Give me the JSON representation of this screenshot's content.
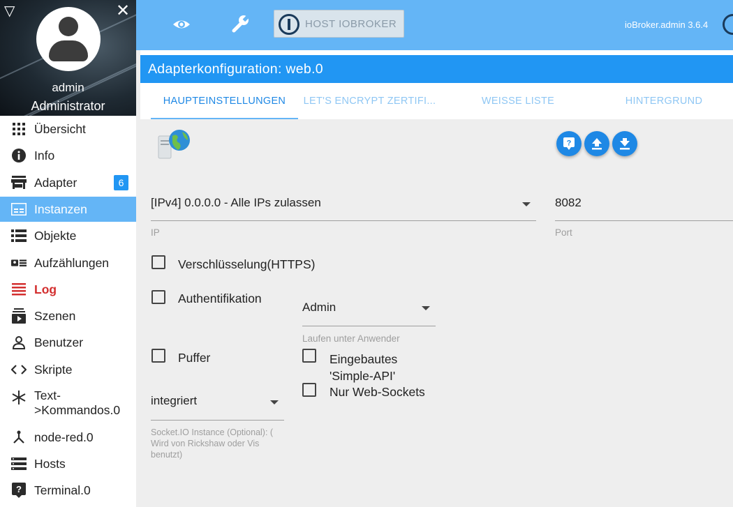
{
  "sidebar": {
    "user": {
      "name": "admin",
      "role": "Administrator"
    },
    "items": [
      {
        "label": "Übersicht",
        "icon": "grid-icon"
      },
      {
        "label": "Info",
        "icon": "info-icon"
      },
      {
        "label": "Adapter",
        "icon": "store-icon",
        "badge": "6"
      },
      {
        "label": "Instanzen",
        "icon": "instances-icon",
        "active": true
      },
      {
        "label": "Objekte",
        "icon": "list-icon"
      },
      {
        "label": "Aufzählungen",
        "icon": "enum-icon"
      },
      {
        "label": "Log",
        "icon": "log-icon",
        "highlight": "#d32f2f"
      },
      {
        "label": "Szenen",
        "icon": "scenes-icon"
      },
      {
        "label": "Benutzer",
        "icon": "user-icon"
      },
      {
        "label": "Skripte",
        "icon": "code-icon"
      },
      {
        "label": "Text-\n>Kommandos.0",
        "icon": "snowflake-icon"
      },
      {
        "label": "node-red.0",
        "icon": "node-red-icon"
      },
      {
        "label": "Hosts",
        "icon": "hosts-icon"
      },
      {
        "label": "Terminal.0",
        "icon": "terminal-icon"
      }
    ]
  },
  "topbar": {
    "host_label": "HOST IOBROKER",
    "version": "ioBroker.admin 3.6.4"
  },
  "main": {
    "title": "Adapterkonfiguration: web.0",
    "tabs": [
      {
        "label": "HAUPTEINSTELLUNGEN",
        "active": true
      },
      {
        "label": "LET'S ENCRYPT ZERTIFI..."
      },
      {
        "label": "WEISSE LISTE"
      },
      {
        "label": "HINTERGRUND"
      }
    ],
    "ip": {
      "value": "[IPv4] 0.0.0.0 - Alle IPs zulassen",
      "label": "IP"
    },
    "port": {
      "value": "8082",
      "label": "Port"
    },
    "https": {
      "label": "Verschlüsselung(HTTPS)",
      "checked": false
    },
    "auth": {
      "label": "Authentifikation",
      "checked": false
    },
    "run_as": {
      "value": "Admin",
      "label": "Laufen unter Anwender"
    },
    "cache": {
      "label": "Puffer",
      "checked": false
    },
    "simple_api": {
      "label": "Eingebautes 'Simple-API'",
      "checked": false
    },
    "websockets": {
      "label": "Nur Web-Sockets",
      "checked": false
    },
    "socketio": {
      "value": "integriert",
      "label": "Socket.IO Instance (Optional): (    Wird von Rickshaw oder Vis benutzt)"
    }
  },
  "colors": {
    "accent": "#2196f3",
    "topbar": "#64b5f6",
    "log": "#d32f2f"
  }
}
